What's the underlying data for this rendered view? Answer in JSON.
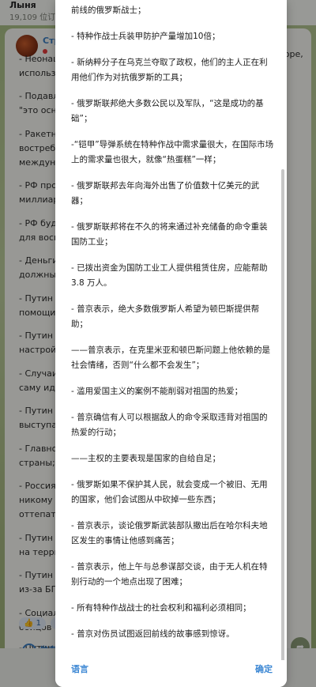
{
  "background": {
    "channel_name": "Лыня",
    "subscribers": "19,109 位订",
    "chat_channel": "Стран",
    "right_text": "ь горе,",
    "lines": [
      "- Неонаци",
      "используя",
      "- Подавля",
      "\"это осно",
      "- Ракетны",
      "востребо",
      "междунар",
      "- РФ прод",
      "миллиард",
      "- РФ будет",
      "для воспо",
      "- Деньги н",
      "должны п",
      "- Путин за",
      "помощи Д",
      "- Путин за",
      "настрой с",
      "- Случаи з",
      "саму идее",
      "- Путин ув",
      "выступать",
      "- Главное",
      "страны;",
      "- Россия,",
      "никому не",
      "оттепать;",
      "- Путин за",
      "на террит",
      "- Путин за",
      "из-за БПЛ",
      "- Социаль",
      "бойцов сп",
      "- Путин по",
      "на фронт."
    ],
    "reactions": [
      "👍 1",
      "🙏"
    ],
    "footer_label": "发表",
    "share_icon": "share-icon"
  },
  "dialog": {
    "paragraphs": [
      "前线的俄罗斯战士；",
      "- 特种作战士兵装甲防护产量增加10倍；",
      "- 新纳粹分子在乌克兰夺取了政权，他们的主人正在利用他们作为对抗俄罗斯的工具；",
      "- 俄罗斯联邦绝大多数公民以及军队，“这是成功的基础”；",
      "-“铠甲”导弹系统在特种作战中需求量很大，在国际市场上的需求量也很大，就像“热蛋糕”一样；",
      "- 俄罗斯联邦去年向海外出售了价值数十亿美元的武器；",
      "- 俄罗斯联邦将在不久的将来通过补充储备的命令重装国防工业；",
      "- 已拨出资金为国防工业工人提供租赁住房，应能帮助 3.8 万人。",
      "- 普京表示，绝大多数俄罗斯人希望为顿巴斯提供帮助；",
      "——普京表示，在克里米亚和顿巴斯问题上他依赖的是社会情绪，否则“什么都不会发生”；",
      "- 滥用爱国主义的案例不能削弱对祖国的热爱；",
      "- 普京确信有人可以根据敌人的命令采取违背对祖国的热爱的行动；",
      "——主权的主要表现是国家的自给自足；",
      "- 俄罗斯如果不保护其人民，就会变成一个被旧、无用的国家，他们会试图从中砍掉一些东西；",
      "- 普京表示，谈论俄罗斯武装部队撤出后在哈尔科夫地区发生的事情让他感到痛苦；",
      "- 普京表示，他上午与总参谋部交谈，由于无人机在特别行动的一个地点出现了困难；",
      "- 所有特种作战战士的社会权利和福利必须相同；",
      "- 普京对伤员试图返回前线的故事感到惊讶。"
    ],
    "actions": {
      "language": "语言",
      "confirm": "确定"
    }
  }
}
